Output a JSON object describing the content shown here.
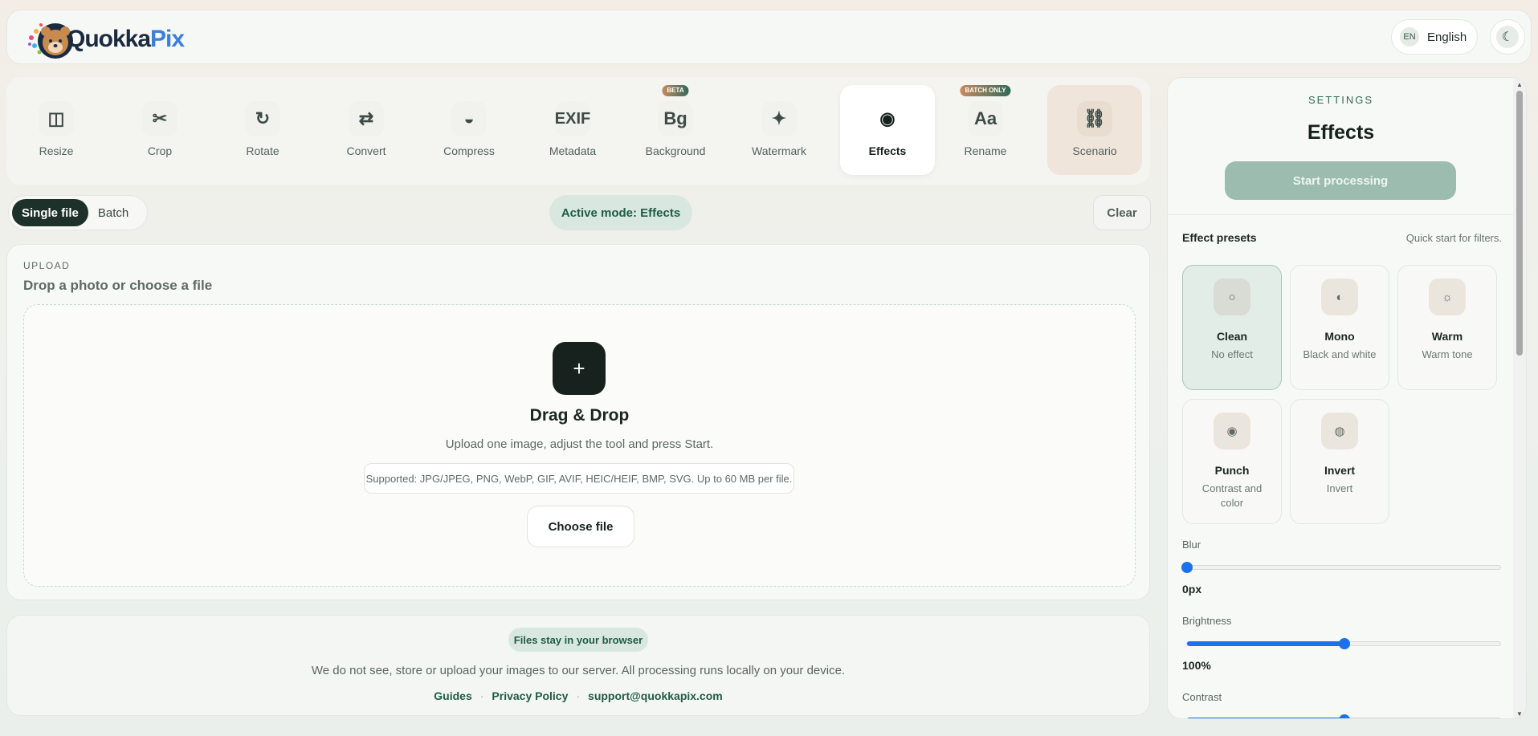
{
  "header": {
    "logo_text_q": "Quokka",
    "logo_text_pix": "Pix",
    "lang_code": "EN",
    "lang_label": "English",
    "theme_icon": "moon-icon"
  },
  "tools": [
    {
      "label": "Resize",
      "glyph": "◫",
      "icon": "resize-icon"
    },
    {
      "label": "Crop",
      "glyph": "✂",
      "icon": "scissors-icon"
    },
    {
      "label": "Rotate",
      "glyph": "↻",
      "icon": "rotate-icon"
    },
    {
      "label": "Convert",
      "glyph": "⇄",
      "icon": "convert-icon"
    },
    {
      "label": "Compress",
      "glyph": "◒",
      "icon": "compress-icon"
    },
    {
      "label": "Metadata",
      "glyph": "EXIF",
      "icon": "exif-icon"
    },
    {
      "label": "Background",
      "glyph": "Bg",
      "icon": "background-icon",
      "tag": "BETA"
    },
    {
      "label": "Watermark",
      "glyph": "✦",
      "icon": "sparkle-icon"
    },
    {
      "label": "Effects",
      "glyph": "◉",
      "icon": "effects-icon"
    },
    {
      "label": "Rename",
      "glyph": "Aa",
      "icon": "rename-icon",
      "tag": "BATCH ONLY"
    },
    {
      "label": "Scenario",
      "glyph": "⛓",
      "icon": "chain-icon"
    }
  ],
  "mode": {
    "single": "Single file",
    "batch": "Batch",
    "active_mode": "Active mode: Effects",
    "clear": "Clear"
  },
  "upload": {
    "kicker": "UPLOAD",
    "title": "Drop a photo or choose a file",
    "plus": "+",
    "dd_title": "Drag & Drop",
    "dd_sub": "Upload one image, adjust the tool and press Start.",
    "supported": "Supported: JPG/JPEG, PNG, WebP, GIF, AVIF, HEIC/HEIF, BMP, SVG. Up to 60 MB per file.",
    "choose": "Choose file"
  },
  "footer": {
    "badge": "Files stay in your browser",
    "text": "We do not see, store or upload your images to our server. All processing runs locally on your device.",
    "links": [
      "Guides",
      "Privacy Policy",
      "support@quokkapix.com"
    ],
    "separator": "·"
  },
  "settings": {
    "kicker": "SETTINGS",
    "title": "Effects",
    "start": "Start processing",
    "presets_label": "Effect presets",
    "presets_hint": "Quick start for filters.",
    "presets": [
      {
        "name": "Clean",
        "desc": "No effect",
        "glyph": "○",
        "icon": "clean-icon"
      },
      {
        "name": "Mono",
        "desc": "Black and white",
        "glyph": "◐",
        "icon": "mono-icon"
      },
      {
        "name": "Warm",
        "desc": "Warm tone",
        "glyph": "☼",
        "icon": "sun-icon"
      },
      {
        "name": "Punch",
        "desc": "Contrast and color",
        "glyph": "◉",
        "icon": "punch-icon"
      },
      {
        "name": "Invert",
        "desc": "Invert",
        "glyph": "◍",
        "icon": "invert-icon"
      }
    ],
    "selected_preset": "Clean",
    "sliders": [
      {
        "label": "Blur",
        "value": "0px",
        "fraction": 0.0
      },
      {
        "label": "Brightness",
        "value": "100%",
        "fraction": 0.5
      },
      {
        "label": "Contrast",
        "value": "",
        "fraction": 0.5
      }
    ]
  },
  "colors": {
    "accent": "#1f5c46",
    "slider": "#1a73e8",
    "dark_button": "#17221e",
    "start_button": "#9cbcaf"
  }
}
